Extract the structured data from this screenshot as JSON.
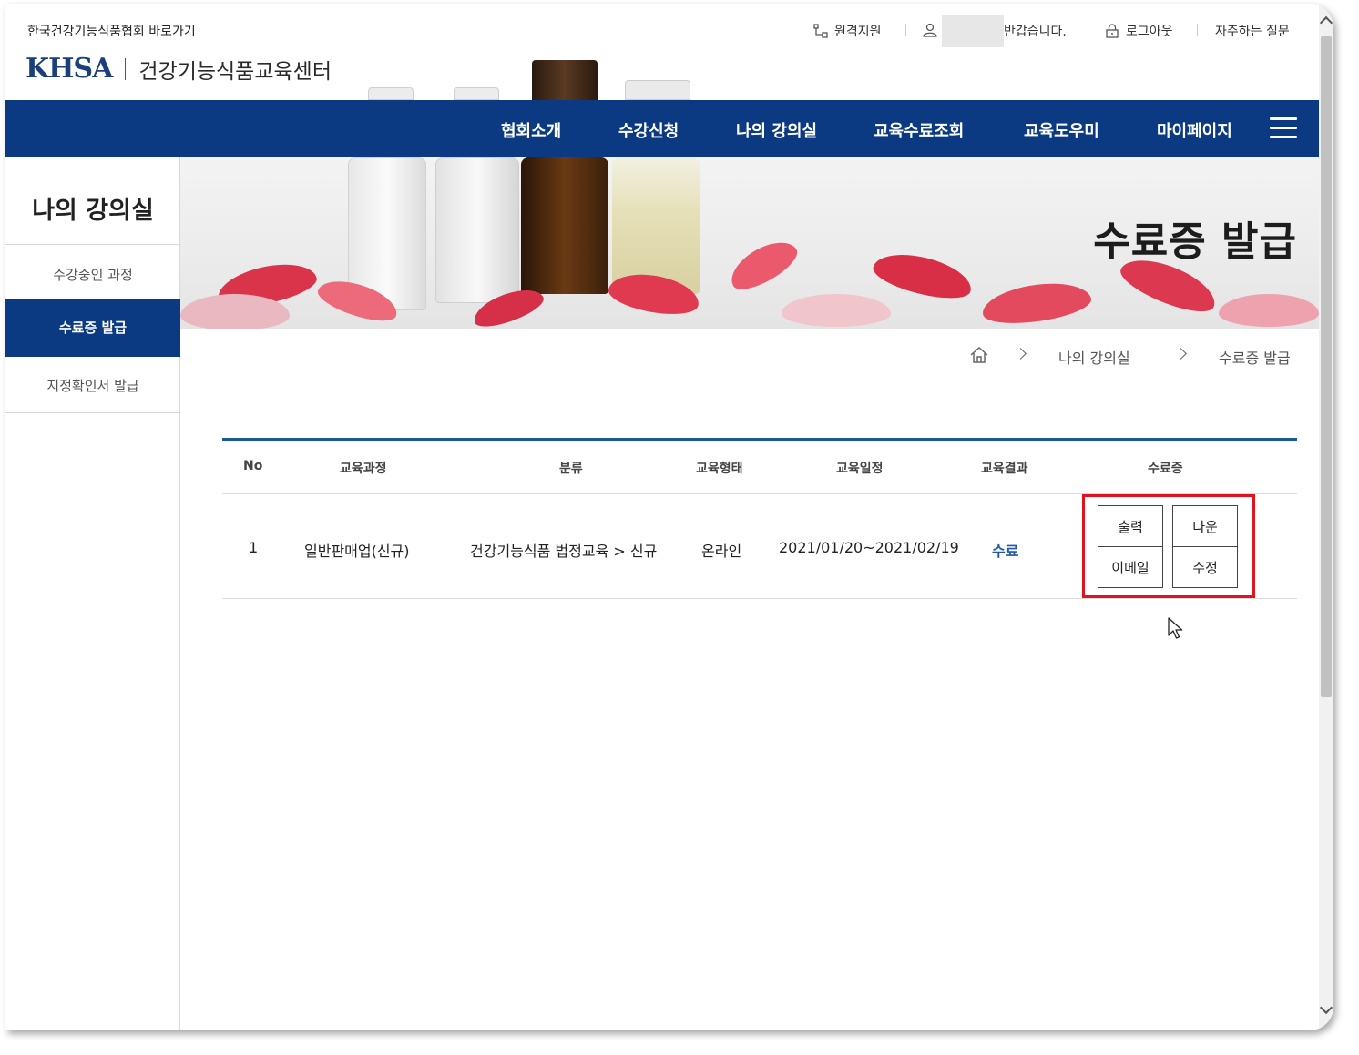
{
  "header": {
    "association_link": "한국건강기능식품협회 바로가기",
    "remote_support": "원격지원",
    "greeting": "반갑습니다.",
    "logout": "로그아웃",
    "faq": "자주하는 질문",
    "logo_mark": "KHSA",
    "logo_text": "건강기능식품교육센터"
  },
  "nav": {
    "items": [
      "협회소개",
      "수강신청",
      "나의 강의실",
      "교육수료조회",
      "교육도우미",
      "마이페이지"
    ]
  },
  "sidebar": {
    "title": "나의 강의실",
    "items": [
      "수강중인 과정",
      "수료증 발급",
      "지정확인서 발급"
    ],
    "active_index": 1
  },
  "hero": {
    "title": "수료증 발급"
  },
  "breadcrumb": {
    "items": [
      "나의 강의실",
      "수료증 발급"
    ]
  },
  "table": {
    "headers": [
      "No",
      "교육과정",
      "분류",
      "교육형태",
      "교육일정",
      "교육결과",
      "수료증"
    ],
    "rows": [
      {
        "no": "1",
        "course": "일반판매업(신규)",
        "category": "건강기능식품 법정교육 > 신규",
        "type": "온라인",
        "schedule": "2021/01/20~2021/02/19",
        "result": "수료"
      }
    ],
    "cert_buttons": {
      "print": "출력",
      "download": "다운",
      "email": "이메일",
      "edit": "수정"
    }
  },
  "colors": {
    "nav_bg": "#0b3a82",
    "table_top": "#1c5a8c",
    "result_text": "#1f5aa6",
    "highlight": "#e0141e"
  }
}
